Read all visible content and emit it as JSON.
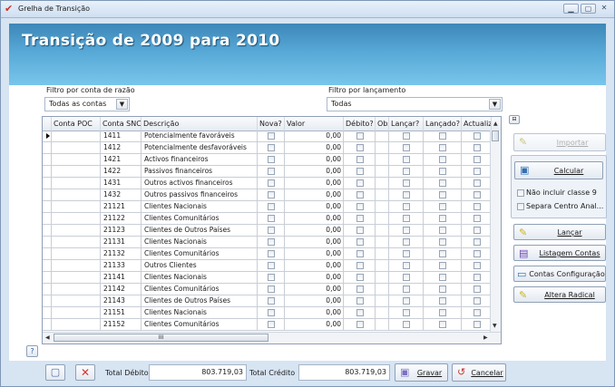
{
  "window": {
    "title": "Grelha de Transição"
  },
  "banner": {
    "title": "Transição de 2009 para 2010"
  },
  "filters": {
    "account_label": "Filtro por conta de razão",
    "account_value": "Todas as contas",
    "posting_label": "Filtro por lançamento",
    "posting_value": "Todas"
  },
  "grid": {
    "columns": [
      "Conta POC",
      "Conta SNC",
      "Descrição",
      "Nova?",
      "Valor",
      "Débito?",
      "Obs",
      "Lançar?",
      "Lançado?",
      "Actualiz"
    ],
    "rows": [
      {
        "poc": "",
        "snc": "1411",
        "desc": "Potencialmente favoráveis",
        "valor": "0,00"
      },
      {
        "poc": "",
        "snc": "1412",
        "desc": "Potencialmente desfavoráveis",
        "valor": "0,00"
      },
      {
        "poc": "",
        "snc": "1421",
        "desc": "Activos financeiros",
        "valor": "0,00"
      },
      {
        "poc": "",
        "snc": "1422",
        "desc": "Passivos financeiros",
        "valor": "0,00"
      },
      {
        "poc": "",
        "snc": "1431",
        "desc": "Outros activos financeiros",
        "valor": "0,00"
      },
      {
        "poc": "",
        "snc": "1432",
        "desc": "Outros passivos financeiros",
        "valor": "0,00"
      },
      {
        "poc": "",
        "snc": "21121",
        "desc": "Clientes Nacionais",
        "valor": "0,00"
      },
      {
        "poc": "",
        "snc": "21122",
        "desc": "Clientes Comunitários",
        "valor": "0,00"
      },
      {
        "poc": "",
        "snc": "21123",
        "desc": "Clientes de Outros Países",
        "valor": "0,00"
      },
      {
        "poc": "",
        "snc": "21131",
        "desc": "Clientes Nacionais",
        "valor": "0,00"
      },
      {
        "poc": "",
        "snc": "21132",
        "desc": "Clientes Comunitários",
        "valor": "0,00"
      },
      {
        "poc": "",
        "snc": "21133",
        "desc": "Outros Clientes",
        "valor": "0,00"
      },
      {
        "poc": "",
        "snc": "21141",
        "desc": "Clientes Nacionais",
        "valor": "0,00"
      },
      {
        "poc": "",
        "snc": "21142",
        "desc": "Clientes Comunitários",
        "valor": "0,00"
      },
      {
        "poc": "",
        "snc": "21143",
        "desc": "Clientes de Outros Países",
        "valor": "0,00"
      },
      {
        "poc": "",
        "snc": "21151",
        "desc": "Clientes Nacionais",
        "valor": "0,00"
      },
      {
        "poc": "",
        "snc": "21152",
        "desc": "Clientes Comunitários",
        "valor": "0,00"
      }
    ],
    "hscroll_grip": "III"
  },
  "side": {
    "importar": "Importar",
    "calcular": "Calcular",
    "opt_classe9": "Não incluir classe 9",
    "opt_centro": "Separa Centro Anal...",
    "lancar": "Lançar",
    "listagem": "Listagem Contas",
    "contas_config": "Contas Configuração",
    "alterar": "Altera Radical"
  },
  "footer": {
    "total_debito_label": "Total Débito",
    "total_debito": "803.719,03",
    "total_credito_label": "Total Crédito",
    "total_credito": "803.719,03",
    "gravar": "Gravar",
    "cancelar": "Cancelar"
  },
  "icons": {
    "app": "transition-app-icon",
    "new": "new-document-icon",
    "delete": "delete-x-icon",
    "save": "save-disk-icon",
    "cancel": "cancel-undo-icon",
    "help": "help-icon"
  },
  "colors": {
    "banner_top": "#3c87b8",
    "banner_bottom": "#79c6ec",
    "window_bg": "#d7e4f2",
    "delete_red": "#d9342b"
  }
}
